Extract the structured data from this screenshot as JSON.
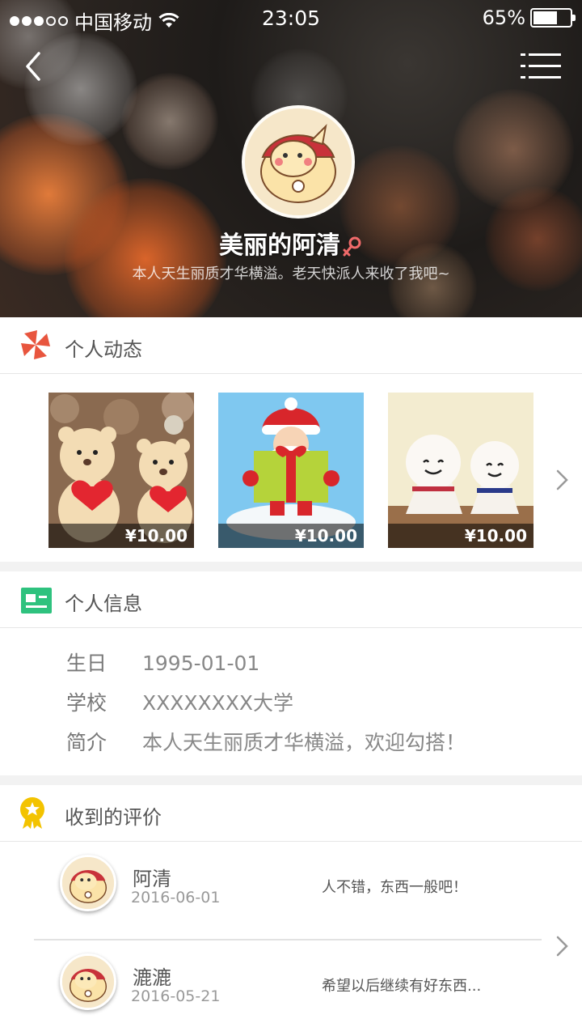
{
  "status": {
    "carrier": "中国移动",
    "time": "23:05",
    "battery": "65%",
    "battery_level": 0.65
  },
  "profile": {
    "name": "美丽的阿清",
    "bio": "本人天生丽质才华横溢。老天快派人来收了我吧~"
  },
  "sections": {
    "moments_title": "个人动态",
    "info_title": "个人信息",
    "reviews_title": "收到的评价"
  },
  "moments": [
    {
      "price": "¥10.00"
    },
    {
      "price": "¥10.00"
    },
    {
      "price": "¥10.00"
    }
  ],
  "info": [
    {
      "label": "生日",
      "value": "1995-01-01"
    },
    {
      "label": "学校",
      "value": "XXXXXXXX大学"
    },
    {
      "label": "简介",
      "value": "本人天生丽质才华横溢，欢迎勾搭！"
    }
  ],
  "reviews": [
    {
      "name": "阿清",
      "date": "2016-06-01",
      "text": "人不错，东西一般吧！"
    },
    {
      "name": "漉漉",
      "date": "2016-05-21",
      "text": "希望以后继续有好东西..."
    }
  ],
  "colors": {
    "moments_icon": "#e8553e",
    "info_icon": "#2ec27e",
    "reviews_icon": "#f3c300"
  }
}
